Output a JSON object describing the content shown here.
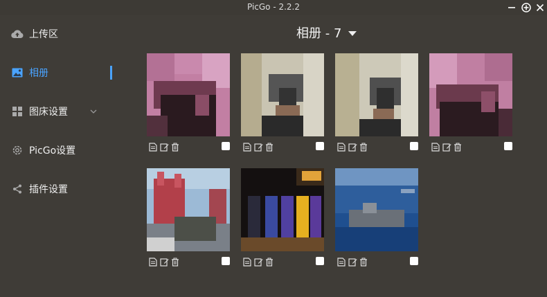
{
  "window": {
    "title": "PicGo - 2.2.2"
  },
  "sidebar": {
    "items": [
      {
        "label": "上传区",
        "icon": "cloud-upload-icon"
      },
      {
        "label": "相册",
        "icon": "image-icon",
        "active": true
      },
      {
        "label": "图床设置",
        "icon": "grid-icon",
        "has_submenu": true
      },
      {
        "label": "PicGo设置",
        "icon": "gear-icon"
      },
      {
        "label": "插件设置",
        "icon": "share-icon"
      }
    ]
  },
  "gallery": {
    "title": "相册 - 7",
    "images": [
      {
        "name": "pink-portrait-1"
      },
      {
        "name": "room-portrait-1"
      },
      {
        "name": "room-portrait-2"
      },
      {
        "name": "pink-portrait-2"
      },
      {
        "name": "red-square-tank"
      },
      {
        "name": "basketball-players"
      },
      {
        "name": "aircraft-carrier"
      }
    ]
  },
  "colors": {
    "accent": "#4aa3ff",
    "background": "#3f3c37"
  }
}
